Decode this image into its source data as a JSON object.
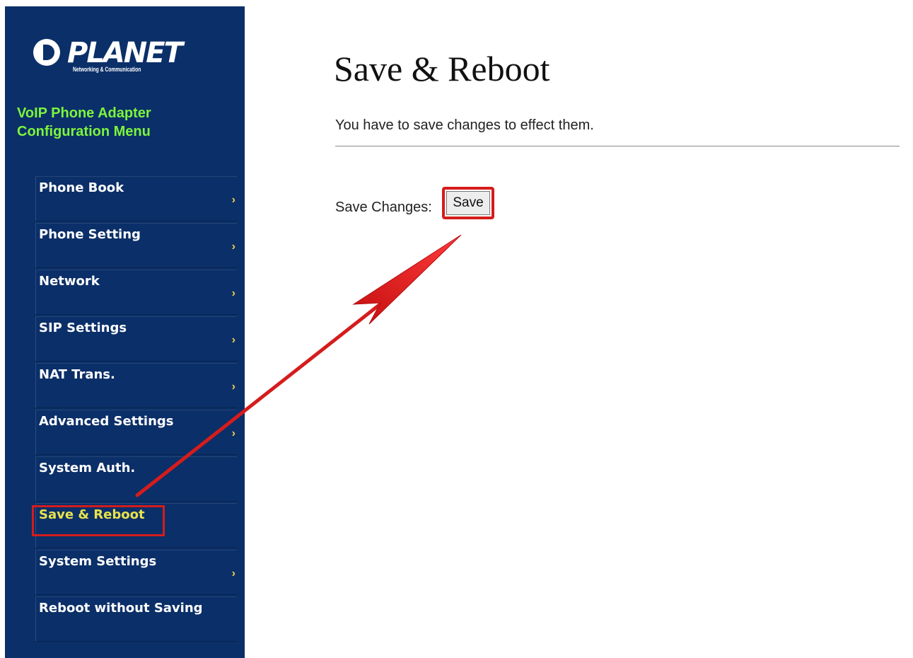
{
  "sidebar": {
    "logo": {
      "name": "PLANET",
      "tagline": "Networking & Communication"
    },
    "menu_title": [
      "VoIP Phone Adapter",
      "Configuration Menu"
    ],
    "items": [
      {
        "label": "Phone Book",
        "has_arrow": true
      },
      {
        "label": "Phone Setting",
        "has_arrow": true
      },
      {
        "label": "Network",
        "has_arrow": true
      },
      {
        "label": "SIP Settings",
        "has_arrow": true
      },
      {
        "label": "NAT Trans.",
        "has_arrow": true
      },
      {
        "label": "Advanced Settings",
        "has_arrow": true
      },
      {
        "label": "System Auth.",
        "has_arrow": false
      },
      {
        "label": "Save & Reboot",
        "has_arrow": false,
        "active": true
      },
      {
        "label": "System Settings",
        "has_arrow": true
      },
      {
        "label": "Reboot without Saving",
        "has_arrow": false
      }
    ],
    "arrow_glyph": "›"
  },
  "main": {
    "title": "Save & Reboot",
    "description": "You have to save changes to effect them.",
    "save_label": "Save Changes:",
    "save_button": "Save"
  },
  "colors": {
    "sidebar_bg": "#0b2f68",
    "menu_title": "#7cf53c",
    "active_item": "#e8e24c",
    "annotation": "#d51c1c"
  }
}
